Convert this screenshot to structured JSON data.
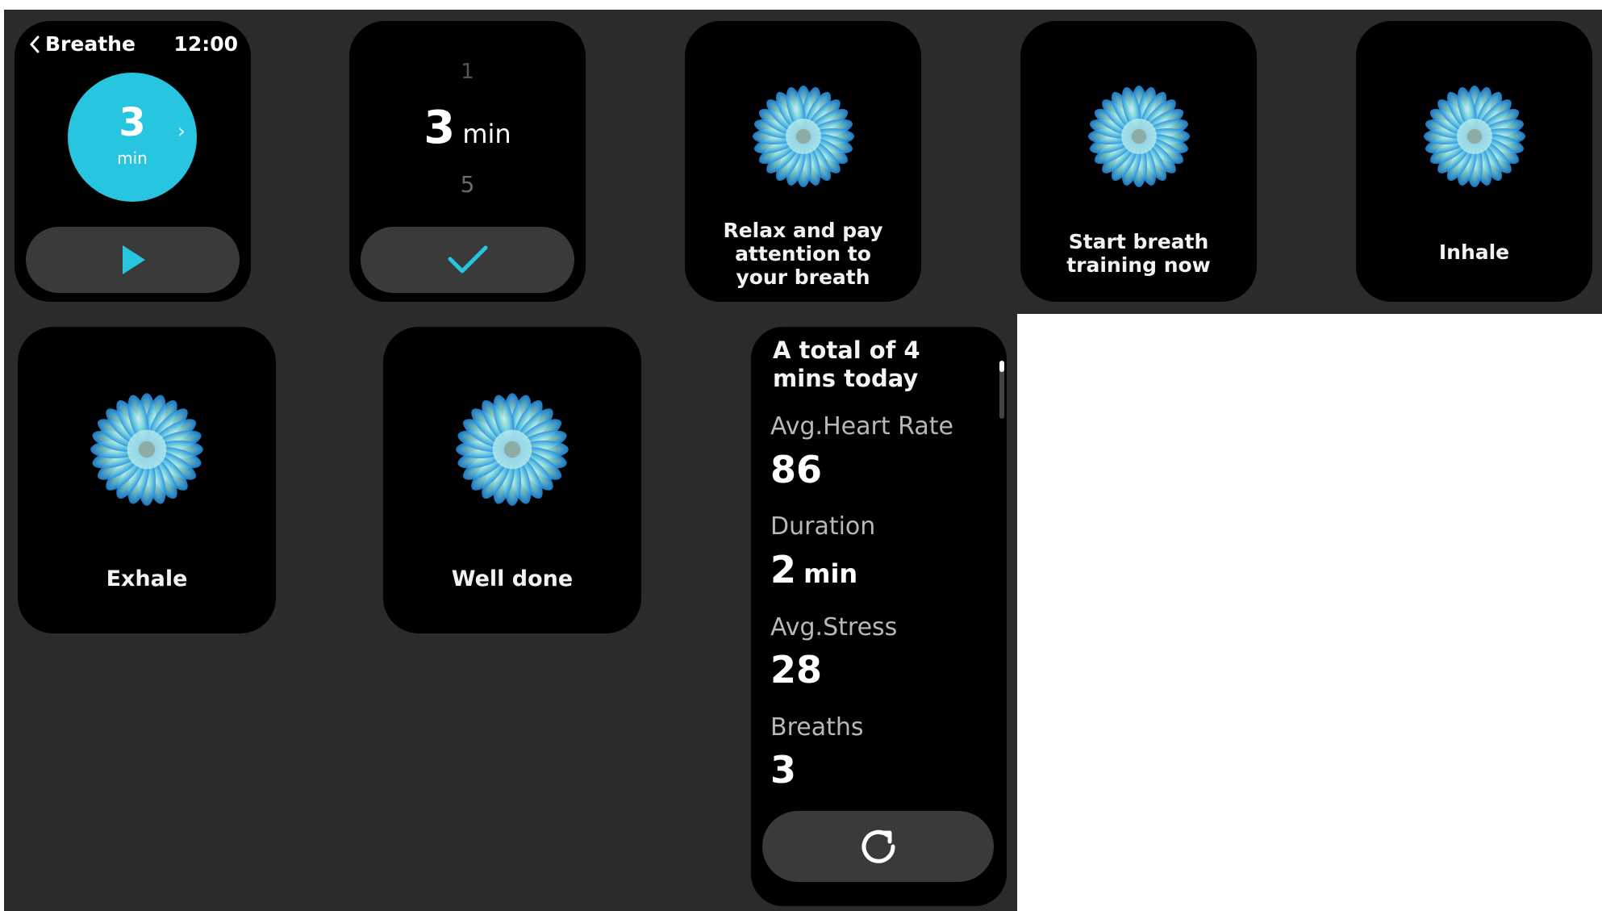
{
  "screen1": {
    "back_label": "Breathe",
    "time": "12:00",
    "duration_value": "3",
    "duration_unit": "min",
    "chevron": "›",
    "accent_color": "#27c5df"
  },
  "screen2": {
    "picker_above": "1",
    "picker_value": "3",
    "picker_unit": "min",
    "picker_below": "5"
  },
  "screen3": {
    "caption": "Relax and pay attention to your breath"
  },
  "screen4": {
    "caption": "Start breath training now"
  },
  "screen5": {
    "caption": "Inhale"
  },
  "screen6": {
    "caption": "Exhale"
  },
  "screen7": {
    "caption": "Well done"
  },
  "summary": {
    "title": "A total of 4 mins today",
    "stats": [
      {
        "label": "Avg.Heart Rate",
        "value": "86",
        "unit": ""
      },
      {
        "label": "Duration",
        "value": "2",
        "unit": "min"
      },
      {
        "label": "Avg.Stress",
        "value": "28",
        "unit": ""
      },
      {
        "label": "Breaths",
        "value": "3",
        "unit": ""
      }
    ]
  },
  "icons": {
    "back": "chevron-left-icon",
    "play": "play-icon",
    "confirm": "checkmark-icon",
    "flower": "breathe-flower-icon",
    "restart": "refresh-icon"
  }
}
